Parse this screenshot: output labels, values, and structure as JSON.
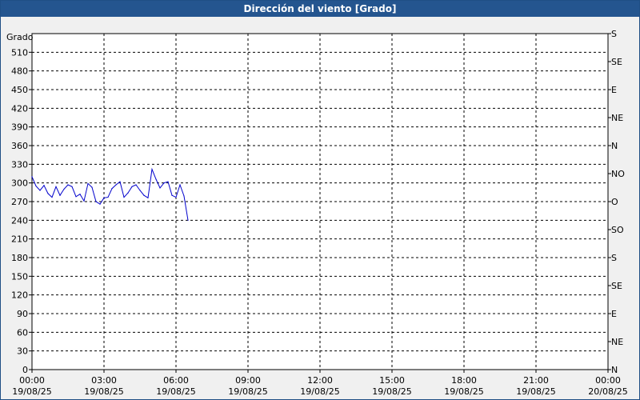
{
  "window": {
    "title": "Dirección del viento [Grado]"
  },
  "chart_data": {
    "type": "line",
    "title": "Dirección del viento [Grado]",
    "ylabel": "Grado",
    "ylim": [
      0,
      540
    ],
    "yticks": [
      0,
      30,
      60,
      90,
      120,
      150,
      180,
      210,
      240,
      270,
      300,
      330,
      360,
      390,
      420,
      450,
      480,
      510
    ],
    "xlim": [
      "19/08/25 00:00",
      "20/08/25 00:00"
    ],
    "xticks": [
      {
        "time": "00:00",
        "date": "19/08/25"
      },
      {
        "time": "03:00",
        "date": "19/08/25"
      },
      {
        "time": "06:00",
        "date": "19/08/25"
      },
      {
        "time": "09:00",
        "date": "19/08/25"
      },
      {
        "time": "12:00",
        "date": "19/08/25"
      },
      {
        "time": "15:00",
        "date": "19/08/25"
      },
      {
        "time": "18:00",
        "date": "19/08/25"
      },
      {
        "time": "21:00",
        "date": "19/08/25"
      },
      {
        "time": "00:00",
        "date": "20/08/25"
      }
    ],
    "right_axis_labels": [
      {
        "value": 0,
        "label": "N"
      },
      {
        "value": 45,
        "label": "NE"
      },
      {
        "value": 90,
        "label": "E"
      },
      {
        "value": 135,
        "label": "SE"
      },
      {
        "value": 180,
        "label": "S"
      },
      {
        "value": 225,
        "label": "SO"
      },
      {
        "value": 270,
        "label": "O"
      },
      {
        "value": 315,
        "label": "NO"
      },
      {
        "value": 360,
        "label": "N"
      },
      {
        "value": 405,
        "label": "NE"
      },
      {
        "value": 450,
        "label": "E"
      },
      {
        "value": 495,
        "label": "SE"
      },
      {
        "value": 540,
        "label": "S"
      }
    ],
    "grid": true,
    "line_color": "#0000cc",
    "series": [
      {
        "x": [
          "00:00",
          "00:10",
          "00:20",
          "00:30",
          "00:40",
          "00:50",
          "01:00",
          "01:10",
          "01:20",
          "01:30",
          "01:40",
          "01:50",
          "02:00",
          "02:10",
          "02:20",
          "02:30",
          "02:40",
          "02:50",
          "03:00",
          "03:10",
          "03:20",
          "03:30",
          "03:40",
          "03:50",
          "04:00",
          "04:10",
          "04:20",
          "04:30",
          "04:40",
          "04:50",
          "05:00",
          "05:10",
          "05:20",
          "05:30",
          "05:40",
          "05:50",
          "06:00",
          "06:10",
          "06:20",
          "06:30"
        ],
        "values": [
          310,
          295,
          288,
          296,
          283,
          277,
          294,
          280,
          290,
          297,
          294,
          278,
          282,
          271,
          299,
          293,
          270,
          266,
          276,
          277,
          291,
          297,
          302,
          277,
          284,
          294,
          297,
          288,
          280,
          276,
          322,
          306,
          292,
          300,
          302,
          280,
          277,
          297,
          279,
          240
        ]
      }
    ]
  }
}
